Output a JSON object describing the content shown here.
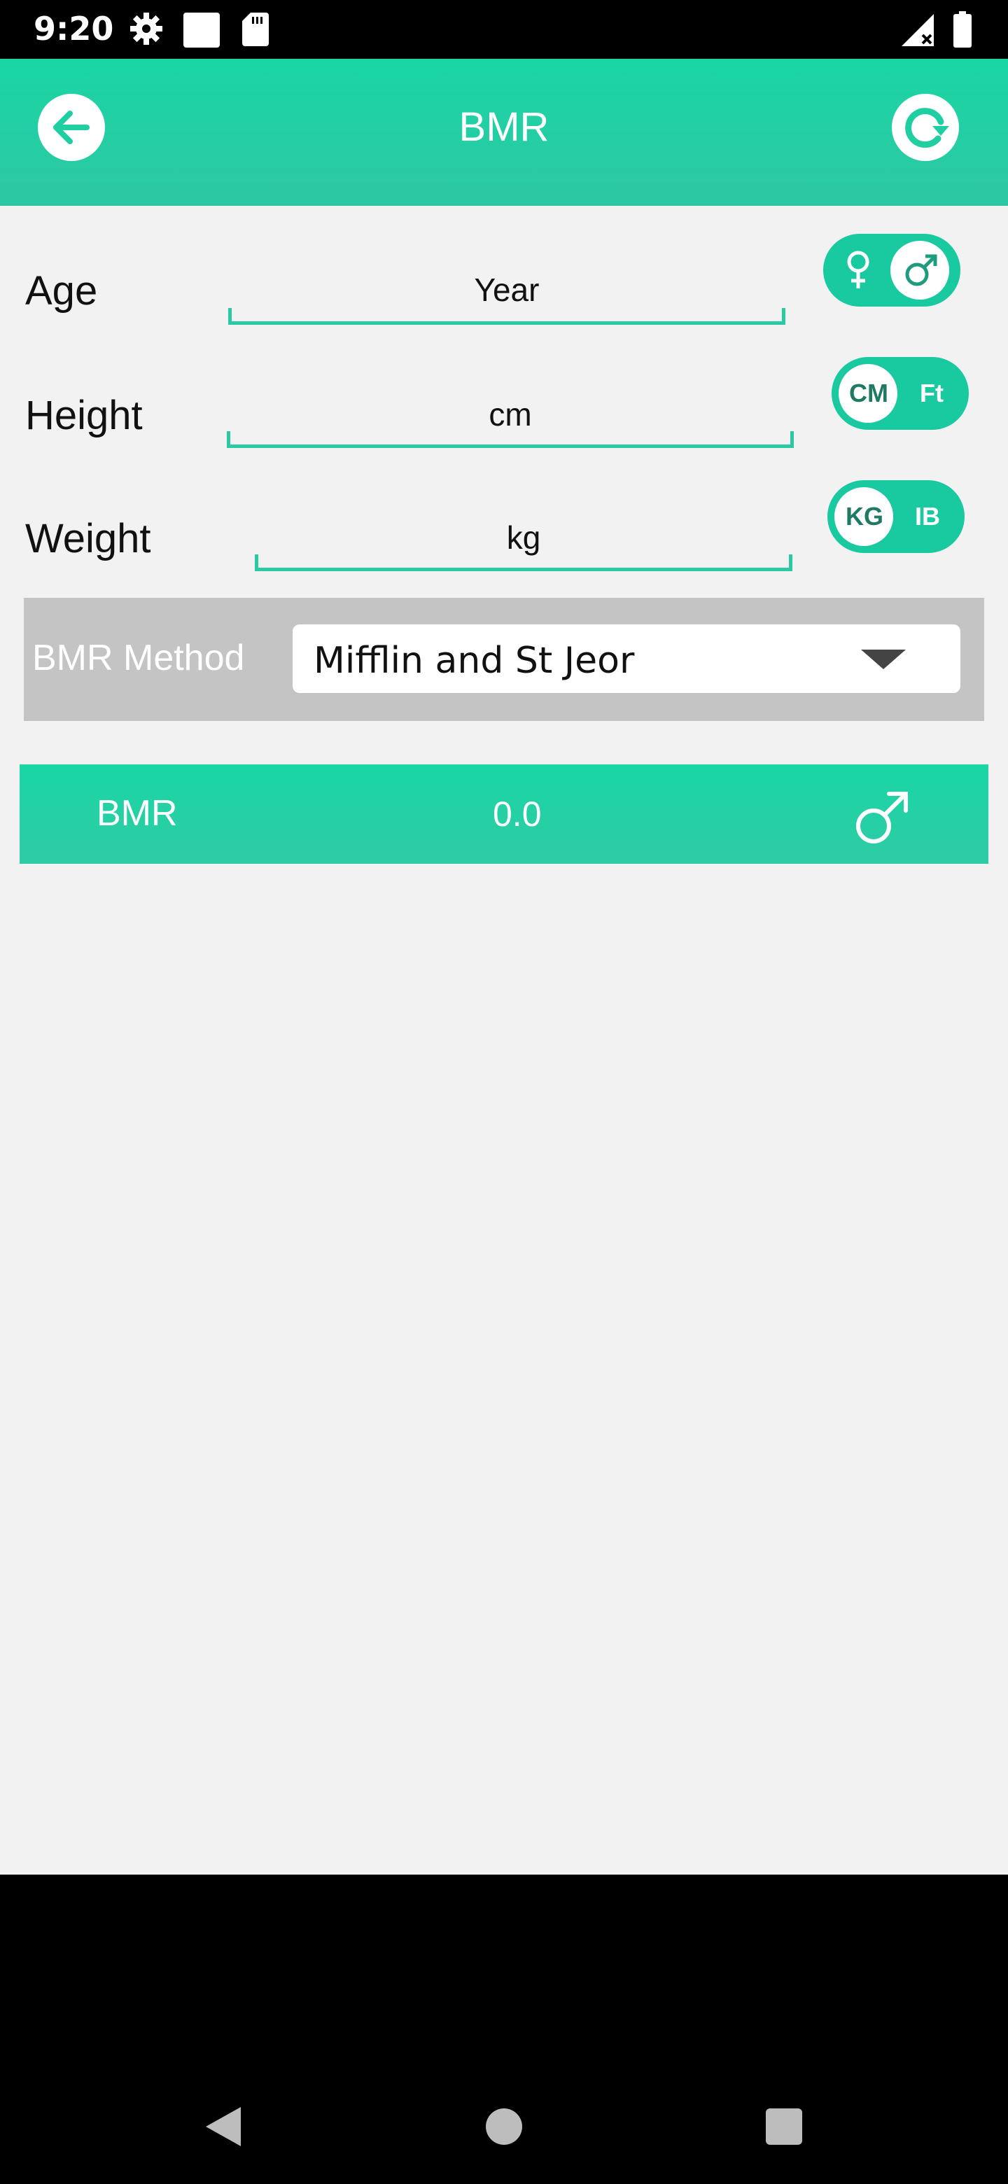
{
  "status_bar": {
    "time": "9:20",
    "icons": [
      "gear-icon",
      "square-notification-icon",
      "sd-card-icon",
      "signal-icon",
      "battery-icon"
    ]
  },
  "app_bar": {
    "title": "BMR",
    "back_icon": "arrow-left-icon",
    "reset_icon": "refresh-icon"
  },
  "fields": {
    "age": {
      "label": "Age",
      "placeholder": "Year",
      "value": ""
    },
    "height": {
      "label": "Height",
      "placeholder": "cm",
      "value": ""
    },
    "weight": {
      "label": "Weight",
      "placeholder": "kg",
      "value": ""
    }
  },
  "toggles": {
    "gender": {
      "options": [
        "female-icon",
        "male-icon"
      ],
      "selected": "male"
    },
    "height_unit": {
      "options": [
        "CM",
        "Ft"
      ],
      "selected": "CM"
    },
    "weight_unit": {
      "options": [
        "KG",
        "IB"
      ],
      "selected": "KG"
    }
  },
  "method": {
    "label": "BMR Method",
    "selected": "Mifflin and St Jeor"
  },
  "result": {
    "label": "BMR",
    "value": "0.0",
    "icon": "male-icon"
  },
  "colors": {
    "accent": "#19d6a4",
    "background": "#f2f2f2",
    "method_box": "#c4c4c4"
  }
}
